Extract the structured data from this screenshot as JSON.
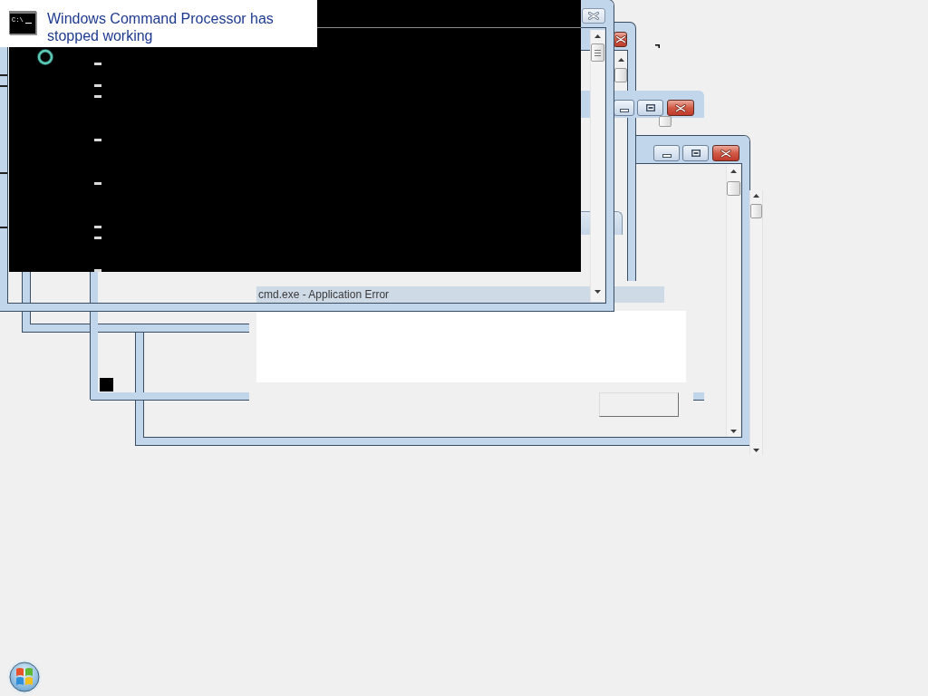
{
  "notification": {
    "icon_label": "C:\\",
    "title": "Windows Command Processor has stopped working"
  },
  "windows": [
    {
      "active": false
    },
    {
      "active": true
    },
    {
      "active": true
    },
    {
      "active": true
    }
  ],
  "error_dialog": {
    "title": "cmd.exe - Application Error"
  }
}
